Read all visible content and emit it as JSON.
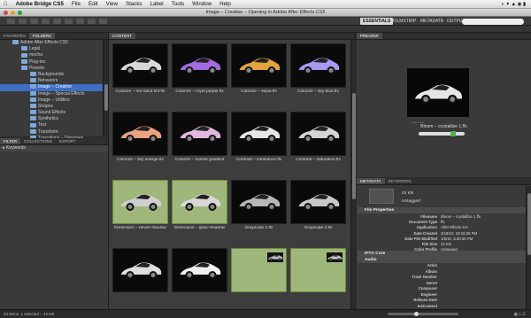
{
  "menubar": {
    "apple": "",
    "app": "Adobe Bridge CS5",
    "items": [
      "File",
      "Edit",
      "View",
      "Stacks",
      "Label",
      "Tools",
      "Window",
      "Help"
    ]
  },
  "title": "Image – Creative – Opening in Adobe After Effects CS5",
  "workspaces": {
    "essentials": "ESSENTIALS",
    "filmstrip": "FILMSTRIP",
    "metadata": "METADATA",
    "output": "OUTPUT"
  },
  "left_tabs": {
    "favorites": "FAVORITES",
    "folders": "FOLDERS"
  },
  "folders": [
    {
      "label": "Adobe After Effects CS5",
      "indent": 1
    },
    {
      "label": "Legal",
      "indent": 2
    },
    {
      "label": "mocha",
      "indent": 2
    },
    {
      "label": "Plug-ins",
      "indent": 2
    },
    {
      "label": "Presets",
      "indent": 2
    },
    {
      "label": "Backgrounds",
      "indent": 3
    },
    {
      "label": "Behaviors",
      "indent": 3
    },
    {
      "label": "Image – Creative",
      "indent": 3,
      "selected": true
    },
    {
      "label": "Image – Special Effects",
      "indent": 3
    },
    {
      "label": "Image – Utilities",
      "indent": 3
    },
    {
      "label": "Shapes",
      "indent": 3
    },
    {
      "label": "Sound Effects",
      "indent": 3
    },
    {
      "label": "Synthetics",
      "indent": 3
    },
    {
      "label": "Text",
      "indent": 3
    },
    {
      "label": "Transform",
      "indent": 3
    },
    {
      "label": "Transitions – Dissolves",
      "indent": 3
    },
    {
      "label": "Transitions – Movement",
      "indent": 3
    },
    {
      "label": "Transitions – Wipes",
      "indent": 3
    }
  ],
  "filter_tabs": {
    "filter": "FILTER",
    "collections": "COLLECTIONS",
    "export": "EXPORT"
  },
  "filter_keywords": "Keywords",
  "content_tab": "CONTENT",
  "thumbnails": [
    {
      "caption": "Colorize – red hand tint.ffx",
      "color": "#d8d8d8",
      "tint": false
    },
    {
      "caption": "Colorize – royal purple.ffx",
      "color": "#a46ae0",
      "tint": false
    },
    {
      "caption": "Colorize – sepia.ffx",
      "color": "#e3a23e",
      "tint": false
    },
    {
      "caption": "Colorize – sky blue.ffx",
      "color": "#a998f0",
      "tint": false
    },
    {
      "caption": "Colorize – sky orange.ffx",
      "color": "#e9a37f",
      "tint": false
    },
    {
      "caption": "Colorize – sunset gradient",
      "color": "#e2b9de",
      "tint": false
    },
    {
      "caption": "Contrast – luminance.ffx",
      "color": "#e6e6e6",
      "tint": false
    },
    {
      "caption": "Contrast – saturation.ffx",
      "color": "#d4d4d4",
      "tint": false
    },
    {
      "caption": "Dimension – bevel+shadow",
      "color": "#cfcfcf",
      "tint": true
    },
    {
      "caption": "Dimension – glow+shadow",
      "color": "#d8d8d8",
      "tint": true
    },
    {
      "caption": "Grayscale 1.ffx",
      "color": "#b8b8b8",
      "tint": false
    },
    {
      "caption": "Grayscale 2.ffx",
      "color": "#c8c8c8",
      "tint": false
    },
    {
      "caption": "",
      "color": "#dedede",
      "tint": false
    },
    {
      "caption": "",
      "color": "#f0f0f0",
      "tint": false
    },
    {
      "caption": "",
      "color": "#c0c0c0",
      "tint": true
    },
    {
      "caption": "",
      "color": "#c8c8c8",
      "tint": true
    }
  ],
  "preview": {
    "tab": "PREVIEW",
    "caption": "Bloom – crystallize 1.ffx",
    "color": "#e6e6e6"
  },
  "metadata_tabs": {
    "metadata": "METADATA",
    "keywords": "KEYWORDS"
  },
  "metadata_summary": {
    "size": "42 KB",
    "tag": "Untagged"
  },
  "file_properties": {
    "header": "File Properties",
    "rows": [
      {
        "k": "Filename",
        "v": "Bloom – crystallize 1.ffx"
      },
      {
        "k": "Document Type",
        "v": "ffx"
      },
      {
        "k": "Application",
        "v": "After Effects 8.0"
      },
      {
        "k": "Date Created",
        "v": "3/18/10, 10:15:36 PM"
      },
      {
        "k": "Date File Modified",
        "v": "1/6/10, 6:30:36 PM"
      },
      {
        "k": "File Size",
        "v": "42 KB"
      },
      {
        "k": "Color Profile",
        "v": "Untagged"
      }
    ]
  },
  "iptc_header": "IPTC Core",
  "audio": {
    "header": "Audio",
    "rows": [
      "Artist",
      "Album",
      "Track Number",
      "Genre",
      "Composer",
      "Engineer",
      "Release Date",
      "Instrument"
    ]
  },
  "status": "34 items, 1 selected – 42 KB"
}
